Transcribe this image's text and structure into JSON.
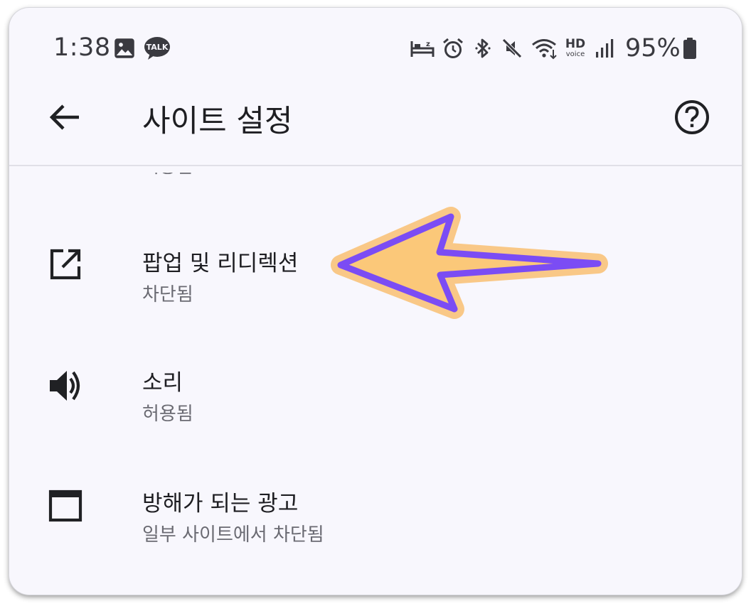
{
  "status_bar": {
    "time": "1:38",
    "notification_icons": [
      "gallery-icon",
      "kakaotalk-icon"
    ],
    "kakaotalk_label": "TALK",
    "system_icons": [
      "sleep-mode-icon",
      "alarm-icon",
      "bluetooth-icon",
      "mute-icon",
      "wifi-icon",
      "hd-voice-icon",
      "signal-icon",
      "battery-icon"
    ],
    "hd_label": "HD",
    "voice_label": "voice",
    "battery_percent": "95%"
  },
  "app_bar": {
    "back_icon": "arrow-back-icon",
    "title": "사이트 설정",
    "help_icon": "help-circle-icon"
  },
  "settings": {
    "partial_top_subtitle": "허용됨",
    "items": [
      {
        "icon": "open-in-new-icon",
        "title": "팝업 및 리디렉션",
        "subtitle": "차단됨"
      },
      {
        "icon": "volume-up-icon",
        "title": "소리",
        "subtitle": "허용됨"
      },
      {
        "icon": "window-icon",
        "title": "방해가 되는 광고",
        "subtitle": "일부 사이트에서 차단됨"
      }
    ]
  },
  "annotation": {
    "type": "arrow-left-pointer",
    "fill_color": "#fbc879",
    "outline_color": "#7b4cf4",
    "glow_color": "#f9c887"
  },
  "colors": {
    "background": "#f8f7fd",
    "text_primary": "#1e1e22",
    "text_secondary": "#6a6a72",
    "icon": "#202124"
  }
}
